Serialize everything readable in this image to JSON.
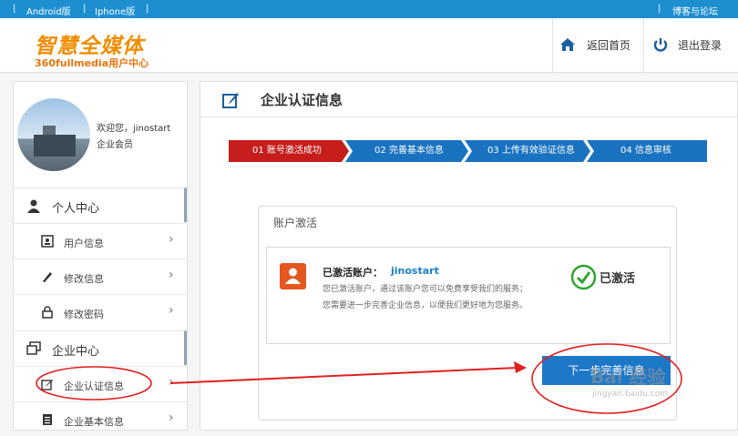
{
  "topbar": {
    "android": "Android版",
    "iphone": "Iphone版",
    "blog": "博客与论坛"
  },
  "header": {
    "logo": "智慧全媒体",
    "subtitle": "360fullmedia用户中心",
    "home": "返回首页",
    "logout": "退出登录"
  },
  "profile": {
    "welcome": "欢迎您，jinostart",
    "role": "企业会员"
  },
  "sidebar": {
    "personal_center": "个人中心",
    "personal_items": [
      {
        "label": "用户信息",
        "icon": "id-card-icon"
      },
      {
        "label": "修改信息",
        "icon": "pencil-icon"
      },
      {
        "label": "修改密码",
        "icon": "lock-icon"
      }
    ],
    "enterprise_center": "企业中心",
    "enterprise_items": [
      {
        "label": "企业认证信息",
        "icon": "edit-icon"
      },
      {
        "label": "企业基本信息",
        "icon": "document-icon"
      }
    ]
  },
  "main": {
    "title": "企业认证信息",
    "steps": [
      "01 账号激活成功",
      "02 完善基本信息",
      "03 上传有效验证信息",
      "04 信息审核"
    ],
    "card_title": "账户激活",
    "activated_label": "已激活账户：",
    "account": "jinostart",
    "desc1": "您已激活账户，通过该账户您可以免费享受我们的服务；",
    "desc2": "您需要进一步完善企业信息，以便我们更好地为您服务。",
    "status": "已激活",
    "next_button": "下一步完善信息"
  },
  "watermark": {
    "text": "Bai 经验",
    "sub": "jingyan.baidu.com"
  },
  "colors": {
    "topbar": "#1d8fd1",
    "step_active": "#c61d1d",
    "step_inactive": "#1a73c0",
    "button": "#1e78c8",
    "annotation": "#e02020",
    "status_green": "#2fa52f"
  }
}
